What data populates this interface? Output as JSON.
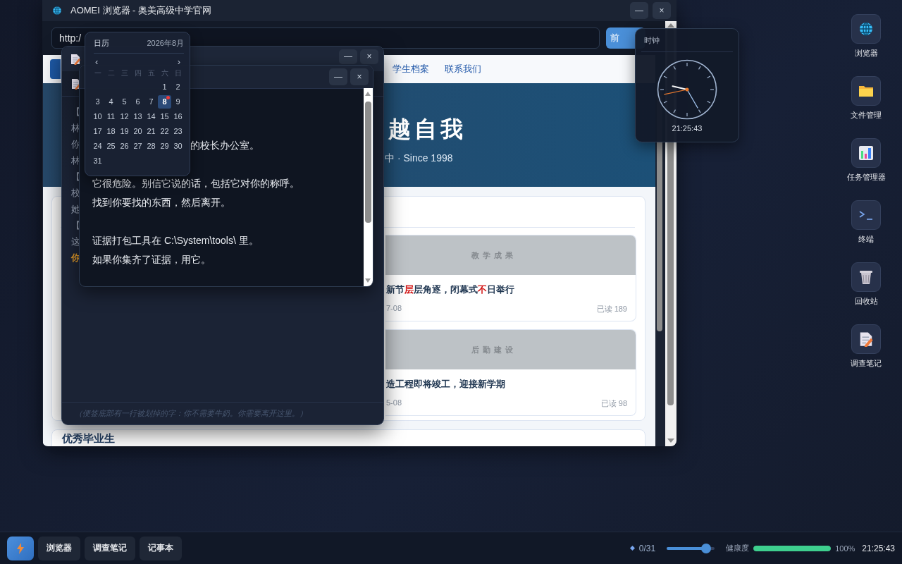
{
  "browser": {
    "title": "AOMEI 浏览器 - 奥美高级中学官网",
    "controls": [
      "—",
      "×"
    ],
    "url": "http:/",
    "go_button": "前",
    "nav": [
      {
        "selected": true
      },
      {
        "label": "学生档案",
        "selected": false
      },
      {
        "label": "联系我们",
        "selected": false
      }
    ],
    "hero": {
      "headline": "越自我",
      "tagline": "中 · Since 1998"
    },
    "news": [
      {
        "category": "教学成果",
        "title": [
          {
            "text": "新节",
            "highlight": false
          },
          {
            "text": "层",
            "highlight": true
          },
          {
            "text": "层角逐，闭幕式",
            "highlight": false
          },
          {
            "text": "不",
            "highlight": true
          },
          {
            "text": "日举行",
            "highlight": false
          }
        ],
        "date": "7-08",
        "reads": "已读 189"
      },
      {
        "category": "后勤建设",
        "title": [
          {
            "text": "造工程即将竣工，迎接新学期",
            "highlight": false
          }
        ],
        "date": "5-08",
        "reads": "已读 98"
      }
    ],
    "next_section": "优秀毕业生"
  },
  "notes_window": {
    "controls": [
      "—",
      "×"
    ],
    "lines": [
      {
        "text": "【",
        "highlight": false
      },
      {
        "text": "林",
        "highlight": false
      },
      {
        "text": "你",
        "highlight": false
      },
      {
        "text": "林",
        "highlight": false
      },
      {
        "text": "【",
        "highlight": false
      },
      {
        "text": "校",
        "highlight": false
      },
      {
        "text": "她",
        "highlight": false
      },
      {
        "text": "【",
        "highlight": false
      },
      {
        "text": "这",
        "highlight": false
      },
      {
        "text": "你",
        "highlight": true
      }
    ],
    "footer": "（便签底部有一行被划掉的字：你不需要牛奶。你需要离开这里。）"
  },
  "note_window": {
    "controls": [
      "—",
      "×"
    ],
    "lines": [
      {
        "kind": "partial",
        "text": "的校长办公室。"
      },
      {
        "kind": "blank"
      },
      {
        "kind": "text",
        "text": "它很危险。别信它说的话，包括它对你的称呼。"
      },
      {
        "kind": "text",
        "text": "找到你要找的东西，然后离开。"
      },
      {
        "kind": "blank"
      },
      {
        "kind": "text",
        "text": "证据打包工具在 C:\\System\\tools\\ 里。"
      },
      {
        "kind": "text",
        "text": "如果你集齐了证据，用它。"
      }
    ]
  },
  "calendar": {
    "title": "日历",
    "month": "2026年8月",
    "prev": "‹",
    "next": "›",
    "weekdays": [
      "一",
      "二",
      "三",
      "四",
      "五",
      "六",
      "日"
    ],
    "weeks": [
      {
        "kind": "tail",
        "days": [
          {
            "day": "1",
            "selected": false
          },
          {
            "day": "2",
            "selected": false
          }
        ]
      },
      {
        "kind": "head",
        "days": [
          {
            "day": "3",
            "selected": false
          },
          {
            "day": "4",
            "selected": false
          },
          {
            "day": "5",
            "selected": false
          },
          {
            "day": "6",
            "selected": false
          },
          {
            "day": "7",
            "selected": false
          },
          {
            "day": "8",
            "selected": true
          },
          {
            "day": "9",
            "selected": false
          }
        ]
      },
      {
        "kind": "head",
        "days": [
          {
            "day": "10",
            "selected": false
          },
          {
            "day": "11",
            "selected": false
          },
          {
            "day": "12",
            "selected": false
          },
          {
            "day": "13",
            "selected": false
          },
          {
            "day": "14",
            "selected": false
          },
          {
            "day": "15",
            "selected": false
          },
          {
            "day": "16",
            "selected": false
          }
        ]
      },
      {
        "kind": "head",
        "days": [
          {
            "day": "17",
            "selected": false
          },
          {
            "day": "18",
            "selected": false
          },
          {
            "day": "19",
            "selected": false
          },
          {
            "day": "20",
            "selected": false
          },
          {
            "day": "21",
            "selected": false
          },
          {
            "day": "22",
            "selected": false
          },
          {
            "day": "23",
            "selected": false
          }
        ]
      },
      {
        "kind": "head",
        "days": [
          {
            "day": "24",
            "selected": false
          },
          {
            "day": "25",
            "selected": false
          },
          {
            "day": "26",
            "selected": false
          },
          {
            "day": "27",
            "selected": false
          },
          {
            "day": "28",
            "selected": false
          },
          {
            "day": "29",
            "selected": false
          },
          {
            "day": "30",
            "selected": false
          }
        ]
      },
      {
        "kind": "head",
        "days": [
          {
            "day": "31",
            "selected": false
          }
        ]
      }
    ]
  },
  "clock": {
    "title": "时钟",
    "time": "21:25:43"
  },
  "desktop_icons": [
    {
      "kind": "globe",
      "label": "浏览器"
    },
    {
      "kind": "folder",
      "label": "文件管理"
    },
    {
      "kind": "chart",
      "label": "任务管理器"
    },
    {
      "kind": "terminal",
      "label": "终端"
    },
    {
      "kind": "trash",
      "label": "回收站"
    },
    {
      "kind": "note",
      "label": "调查笔记"
    }
  ],
  "taskbar": {
    "apps": [
      "浏览器",
      "调查笔记",
      "记事本"
    ],
    "counter": "0/31",
    "slider": {
      "level": 0.9
    },
    "health": {
      "label": "健康度",
      "level": 1.0,
      "reading": "100%"
    },
    "time": "21:25:43"
  }
}
